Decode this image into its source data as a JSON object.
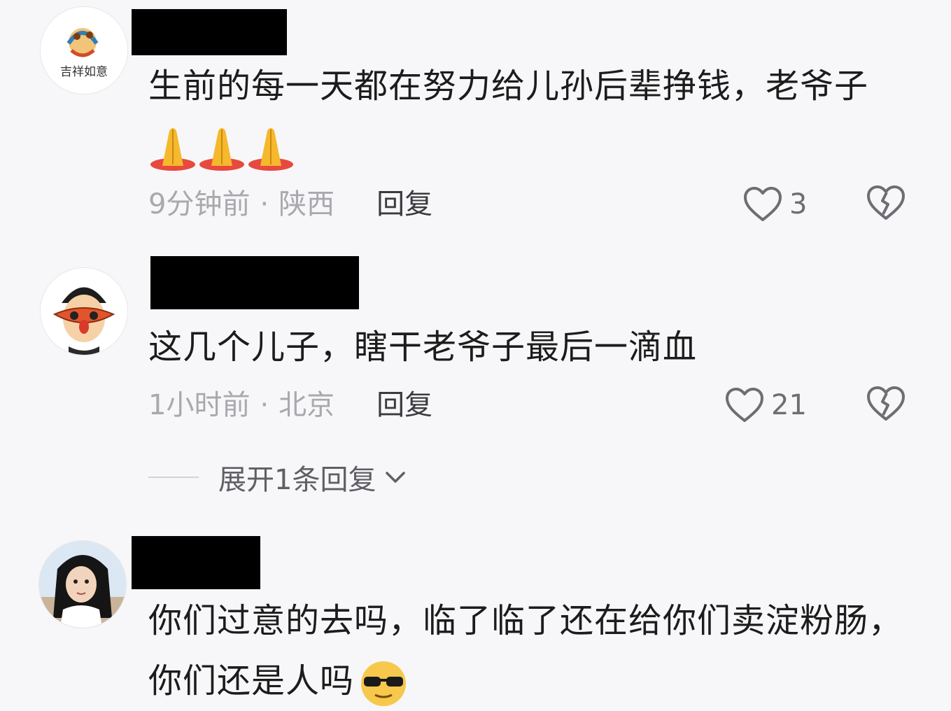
{
  "comments": [
    {
      "text": "生前的每一天都在努力给儿孙后辈挣钱，老爷子",
      "emoji": "folded-hands-icon x3",
      "time": "9分钟前",
      "location": "陕西",
      "reply_label": "回复",
      "likes": "3",
      "avatar_text": "吉祥如意"
    },
    {
      "text": "这几个儿子，瞎干老爷子最后一滴血",
      "time": "1小时前",
      "location": "北京",
      "reply_label": "回复",
      "likes": "21"
    },
    {
      "text": "你们过意的去吗，临了临了还在给你们卖淀粉肠，你们还是人吗",
      "emoji": "sunglasses-face-icon"
    }
  ],
  "expand_replies_label": "展开1条回复",
  "meta_separator": "·",
  "colors": {
    "background": "#f7f7f9",
    "text": "#1c1c1c",
    "meta": "#a9a9ad",
    "redaction": "#000000"
  }
}
